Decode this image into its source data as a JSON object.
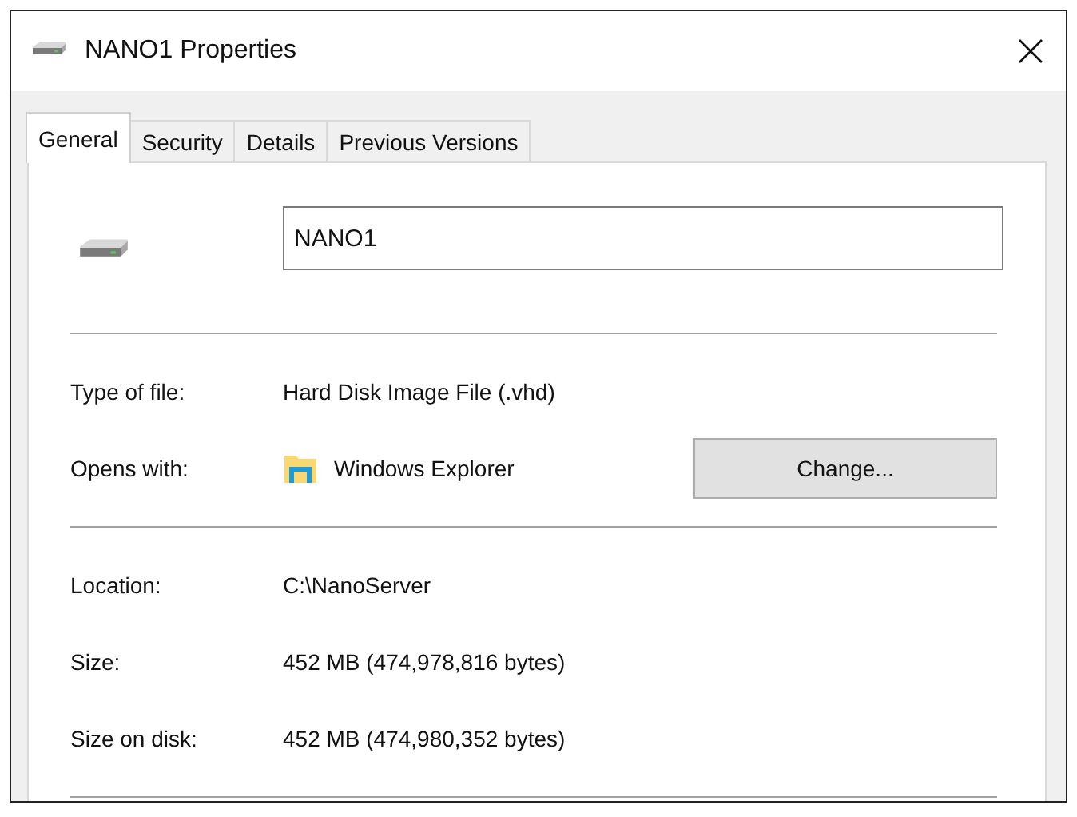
{
  "window": {
    "title": "NANO1 Properties"
  },
  "tabs": [
    {
      "label": "General",
      "selected": true
    },
    {
      "label": "Security",
      "selected": false
    },
    {
      "label": "Details",
      "selected": false
    },
    {
      "label": "Previous Versions",
      "selected": false
    }
  ],
  "name_field": {
    "value": "NANO1"
  },
  "groups": [
    {
      "rows": [
        {
          "kind": "text",
          "label": "Type of file:",
          "value": "Hard Disk Image File (.vhd)"
        },
        {
          "kind": "app",
          "label": "Opens with:",
          "value": "Windows Explorer",
          "button": "Change..."
        }
      ]
    },
    {
      "rows": [
        {
          "kind": "text",
          "label": "Location:",
          "value": "C:\\NanoServer"
        },
        {
          "kind": "text",
          "label": "Size:",
          "value": "452 MB (474,978,816 bytes)"
        },
        {
          "kind": "text",
          "label": "Size on disk:",
          "value": "452 MB (474,980,352 bytes)"
        }
      ]
    }
  ]
}
